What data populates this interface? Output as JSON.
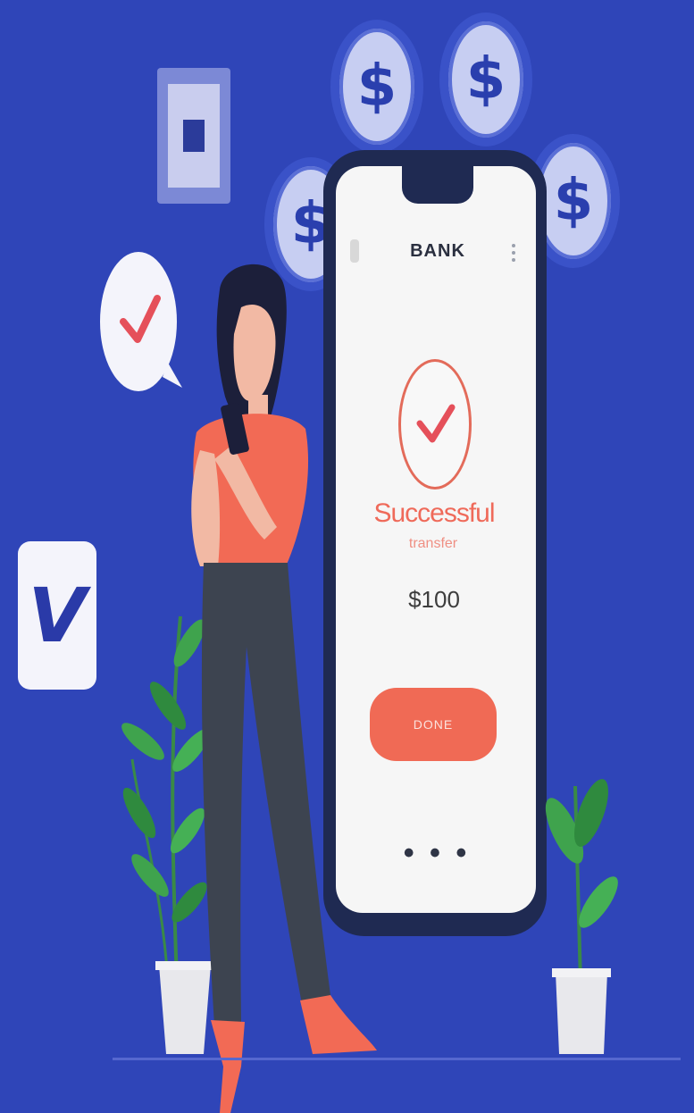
{
  "illustration": {
    "coin_symbol": "$",
    "venmo_letter": "V",
    "colors": {
      "background": "#2f45b8",
      "phone_body": "#1f2a52",
      "accent": "#f06a55",
      "coin": "#c7cef2",
      "plant": "#3fa34d"
    }
  },
  "phone": {
    "header_title": "BANK",
    "status_title": "Successful",
    "status_subtitle": "transfer",
    "amount": "$100",
    "done_button": "DONE",
    "ellipsis": "• • •"
  }
}
